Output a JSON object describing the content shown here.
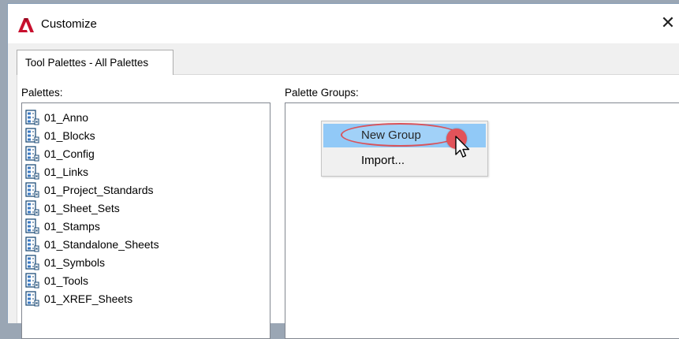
{
  "window": {
    "title": "Customize",
    "close_glyph": "✕",
    "app_icon": "autocad-logo-icon",
    "accent_color": "#c8102e"
  },
  "tabs": [
    {
      "label": "Tool Palettes - All Palettes",
      "selected": true
    }
  ],
  "palettes": {
    "label": "Palettes:",
    "item_icon": "tool-palette-icon",
    "items": [
      "01_Anno",
      "01_Blocks",
      "01_Config",
      "01_Links",
      "01_Project_Standards",
      "01_Sheet_Sets",
      "01_Stamps",
      "01_Standalone_Sheets",
      "01_Symbols",
      "01_Tools",
      "01_XREF_Sheets"
    ]
  },
  "palette_groups": {
    "label": "Palette Groups:"
  },
  "context_menu": {
    "items": [
      {
        "label": "New Group",
        "highlighted": true
      },
      {
        "label": "Import...",
        "highlighted": false
      }
    ],
    "highlight_color": "#91c9f7",
    "annotation_color": "#d9535a"
  }
}
